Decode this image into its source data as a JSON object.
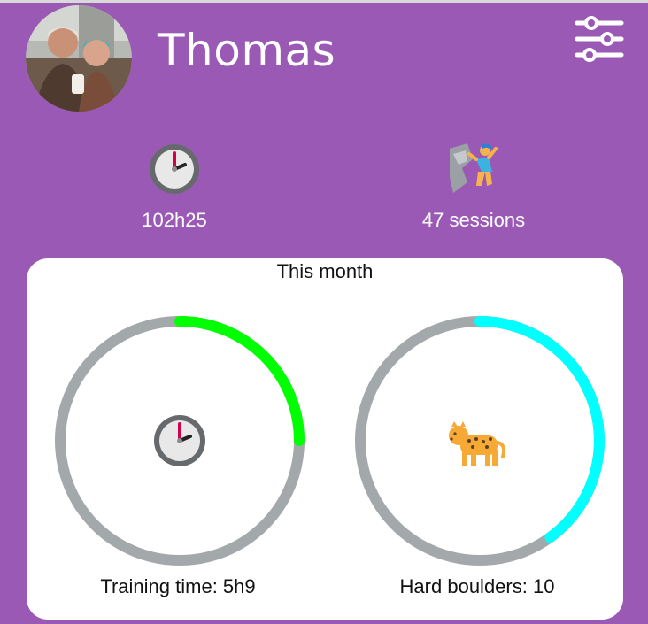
{
  "header": {
    "user_name": "Thomas",
    "avatar_icon": "user-photo-avatar",
    "settings_icon": "sliders-settings-icon"
  },
  "stats": {
    "total_time": "102h25",
    "total_time_icon": "clock-icon",
    "sessions": "47 sessions",
    "sessions_icon": "climber-icon"
  },
  "month_card": {
    "title": "This month",
    "training_time": {
      "label": "Training time: 5h9",
      "progress": 0.25,
      "color": "#00ff00",
      "track_color": "#a3a8ab",
      "icon": "clock-icon"
    },
    "hard_boulders": {
      "label": "Hard boulders: 10",
      "progress": 0.4,
      "color": "#00ffff",
      "track_color": "#a3a8ab",
      "icon": "leopard-icon"
    }
  },
  "colors": {
    "background": "#9b59b6",
    "card": "#ffffff"
  }
}
